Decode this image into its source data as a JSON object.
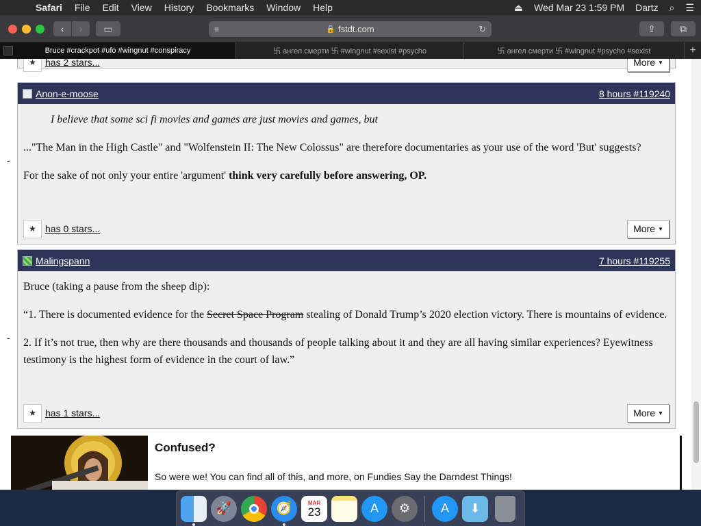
{
  "menubar": {
    "apple_icon": "apple-icon",
    "items": [
      "Safari",
      "File",
      "Edit",
      "View",
      "History",
      "Bookmarks",
      "Window",
      "Help"
    ],
    "datetime": "Wed Mar 23  1:59 PM",
    "user": "Dartz"
  },
  "browser": {
    "url": "fstdt.com",
    "tabs": [
      {
        "label": "Bruce #crackpot #ufo #wingnut #conspiracy",
        "active": true
      },
      {
        "label": "卐 ангел смерти 卐 #wingnut #sexist #psycho",
        "active": false
      },
      {
        "label": "卐 ангел смерти 卐 #wingnut #psycho #sexist",
        "active": false
      }
    ],
    "new_tab_label": "+"
  },
  "prev_post": {
    "stars_text": "has 2 stars...",
    "more_label": "More"
  },
  "posts": [
    {
      "author": "Anon-e-moose",
      "meta": "8 hours #119240",
      "quote": "I believe that some sci fi movies and games are just movies and games, but",
      "para1": "...\"The Man in the High Castle\" and \"Wolfenstein II: The New Colossus\" are therefore documentaries as your use of the word 'But' suggests?",
      "para2_plain": "For the sake of not only your entire 'argument' ",
      "para2_bold": "think very carefully before answering, OP.",
      "stars_text": "has 0 stars...",
      "more_label": "More",
      "side_mark": "-"
    },
    {
      "author": "Malingspann",
      "meta": "7 hours #119255",
      "para1": "Bruce (taking a pause from the sheep dip):",
      "para2_pre": "“1. There is documented evidence for the ",
      "para2_strike": "Secret Space Program",
      "para2_post": " stealing of Donald Trump’s 2020 election victory. There is mountains of evidence.",
      "para3": "2. If it’s not true, then why are there thousands and thousands of people talking about it and they are all having similar experiences? Eyewitness testimony is the highest form of evidence in the court of law.”",
      "stars_text": "has 1 stars...",
      "more_label": "More",
      "side_mark": "-"
    }
  ],
  "banner": {
    "title": "Confused?",
    "text": "So were we! You can find all of this, and more, on Fundies Say the Darndest Things!"
  },
  "dock": [
    "finder",
    "launchpad",
    "chrome",
    "safari",
    "calendar",
    "notes",
    "app-store",
    "system-preferences",
    "app-store-downloads",
    "downloads-folder",
    "trash"
  ],
  "calendar_icon": {
    "month": "MAR",
    "day": "23"
  }
}
